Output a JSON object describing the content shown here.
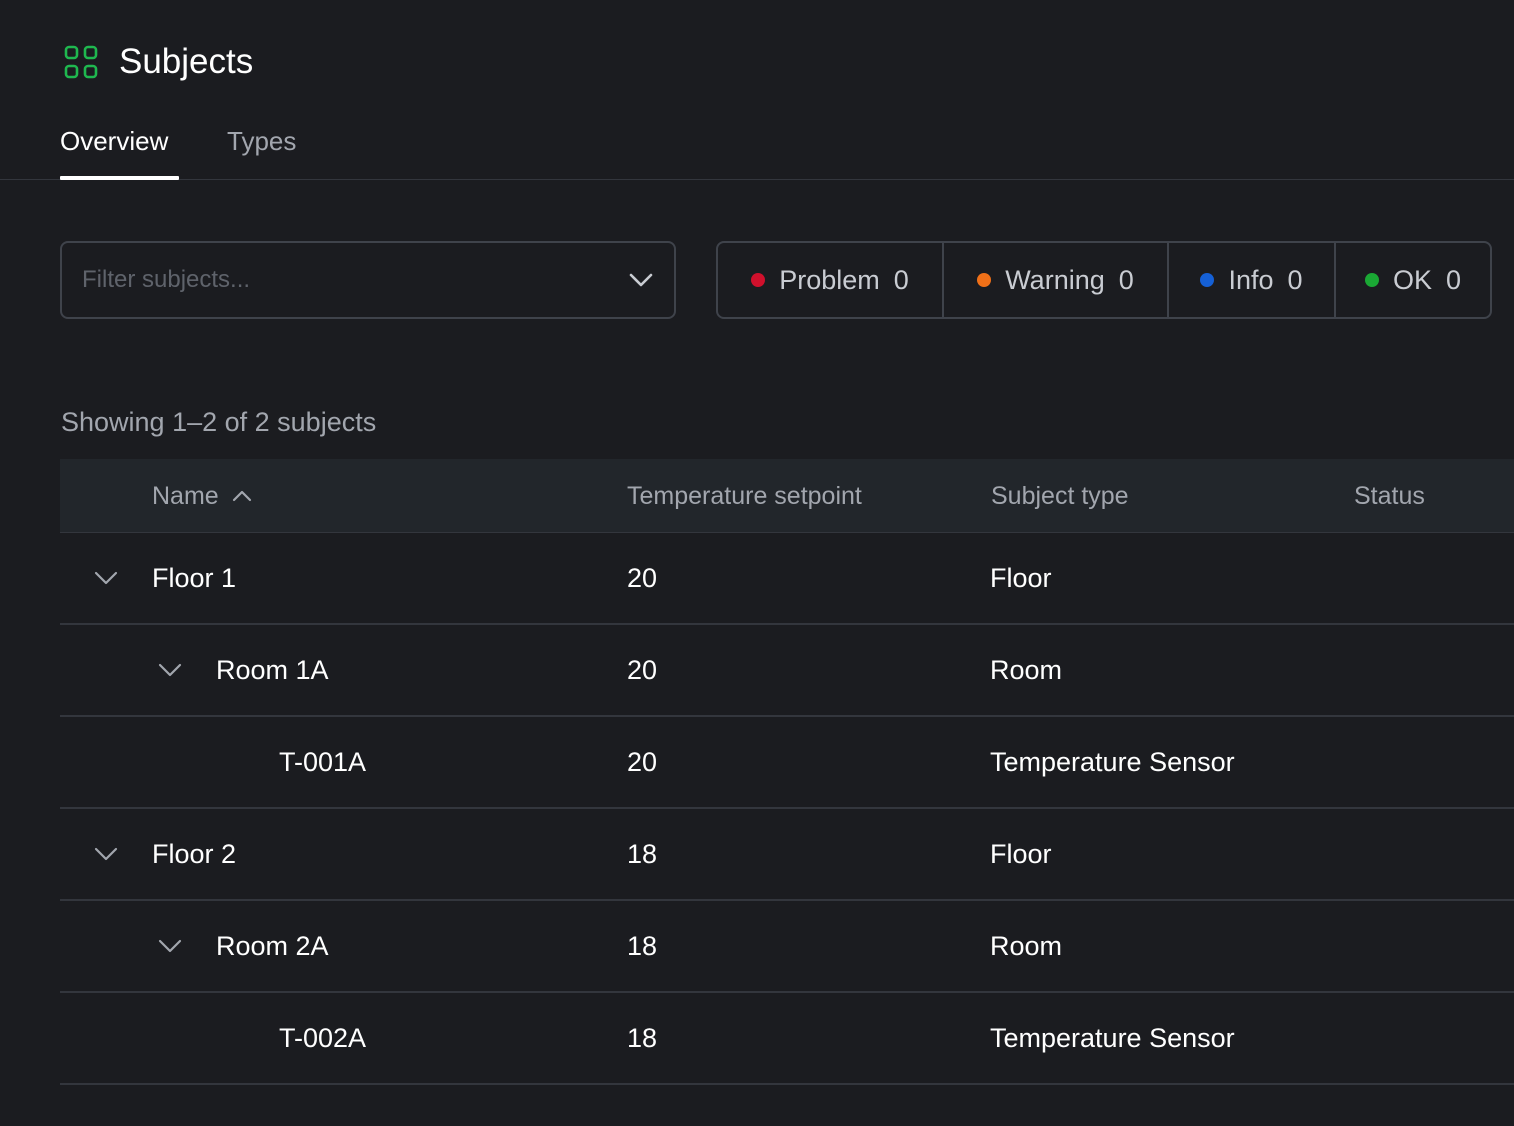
{
  "header": {
    "title": "Subjects",
    "icon": "grid-icon",
    "icon_color": "#1fb84f"
  },
  "tabs": [
    {
      "label": "Overview",
      "active": true
    },
    {
      "label": "Types",
      "active": false
    }
  ],
  "filter": {
    "placeholder": "Filter subjects...",
    "value": ""
  },
  "statuses": [
    {
      "label": "Problem",
      "count": "0",
      "color": "#d0102c"
    },
    {
      "label": "Warning",
      "count": "0",
      "color": "#f07018"
    },
    {
      "label": "Info",
      "count": "0",
      "color": "#1560d6"
    },
    {
      "label": "OK",
      "count": "0",
      "color": "#1aa834"
    }
  ],
  "summary": "Showing 1–2 of 2 subjects",
  "table": {
    "columns": {
      "name": "Name",
      "temperature": "Temperature setpoint",
      "type": "Subject type",
      "status": "Status"
    },
    "sort": "name-ascending",
    "rows": [
      {
        "name": "Floor 1",
        "temperature": "20",
        "type": "Floor",
        "level": 0,
        "expanded": true
      },
      {
        "name": "Room 1A",
        "temperature": "20",
        "type": "Room",
        "level": 1,
        "expanded": true
      },
      {
        "name": "T-001A",
        "temperature": "20",
        "type": "Temperature Sensor",
        "level": 2
      },
      {
        "name": "Floor 2",
        "temperature": "18",
        "type": "Floor",
        "level": 0,
        "expanded": true
      },
      {
        "name": "Room 2A",
        "temperature": "18",
        "type": "Room",
        "level": 1,
        "expanded": true
      },
      {
        "name": "T-002A",
        "temperature": "18",
        "type": "Temperature Sensor",
        "level": 2
      }
    ]
  }
}
